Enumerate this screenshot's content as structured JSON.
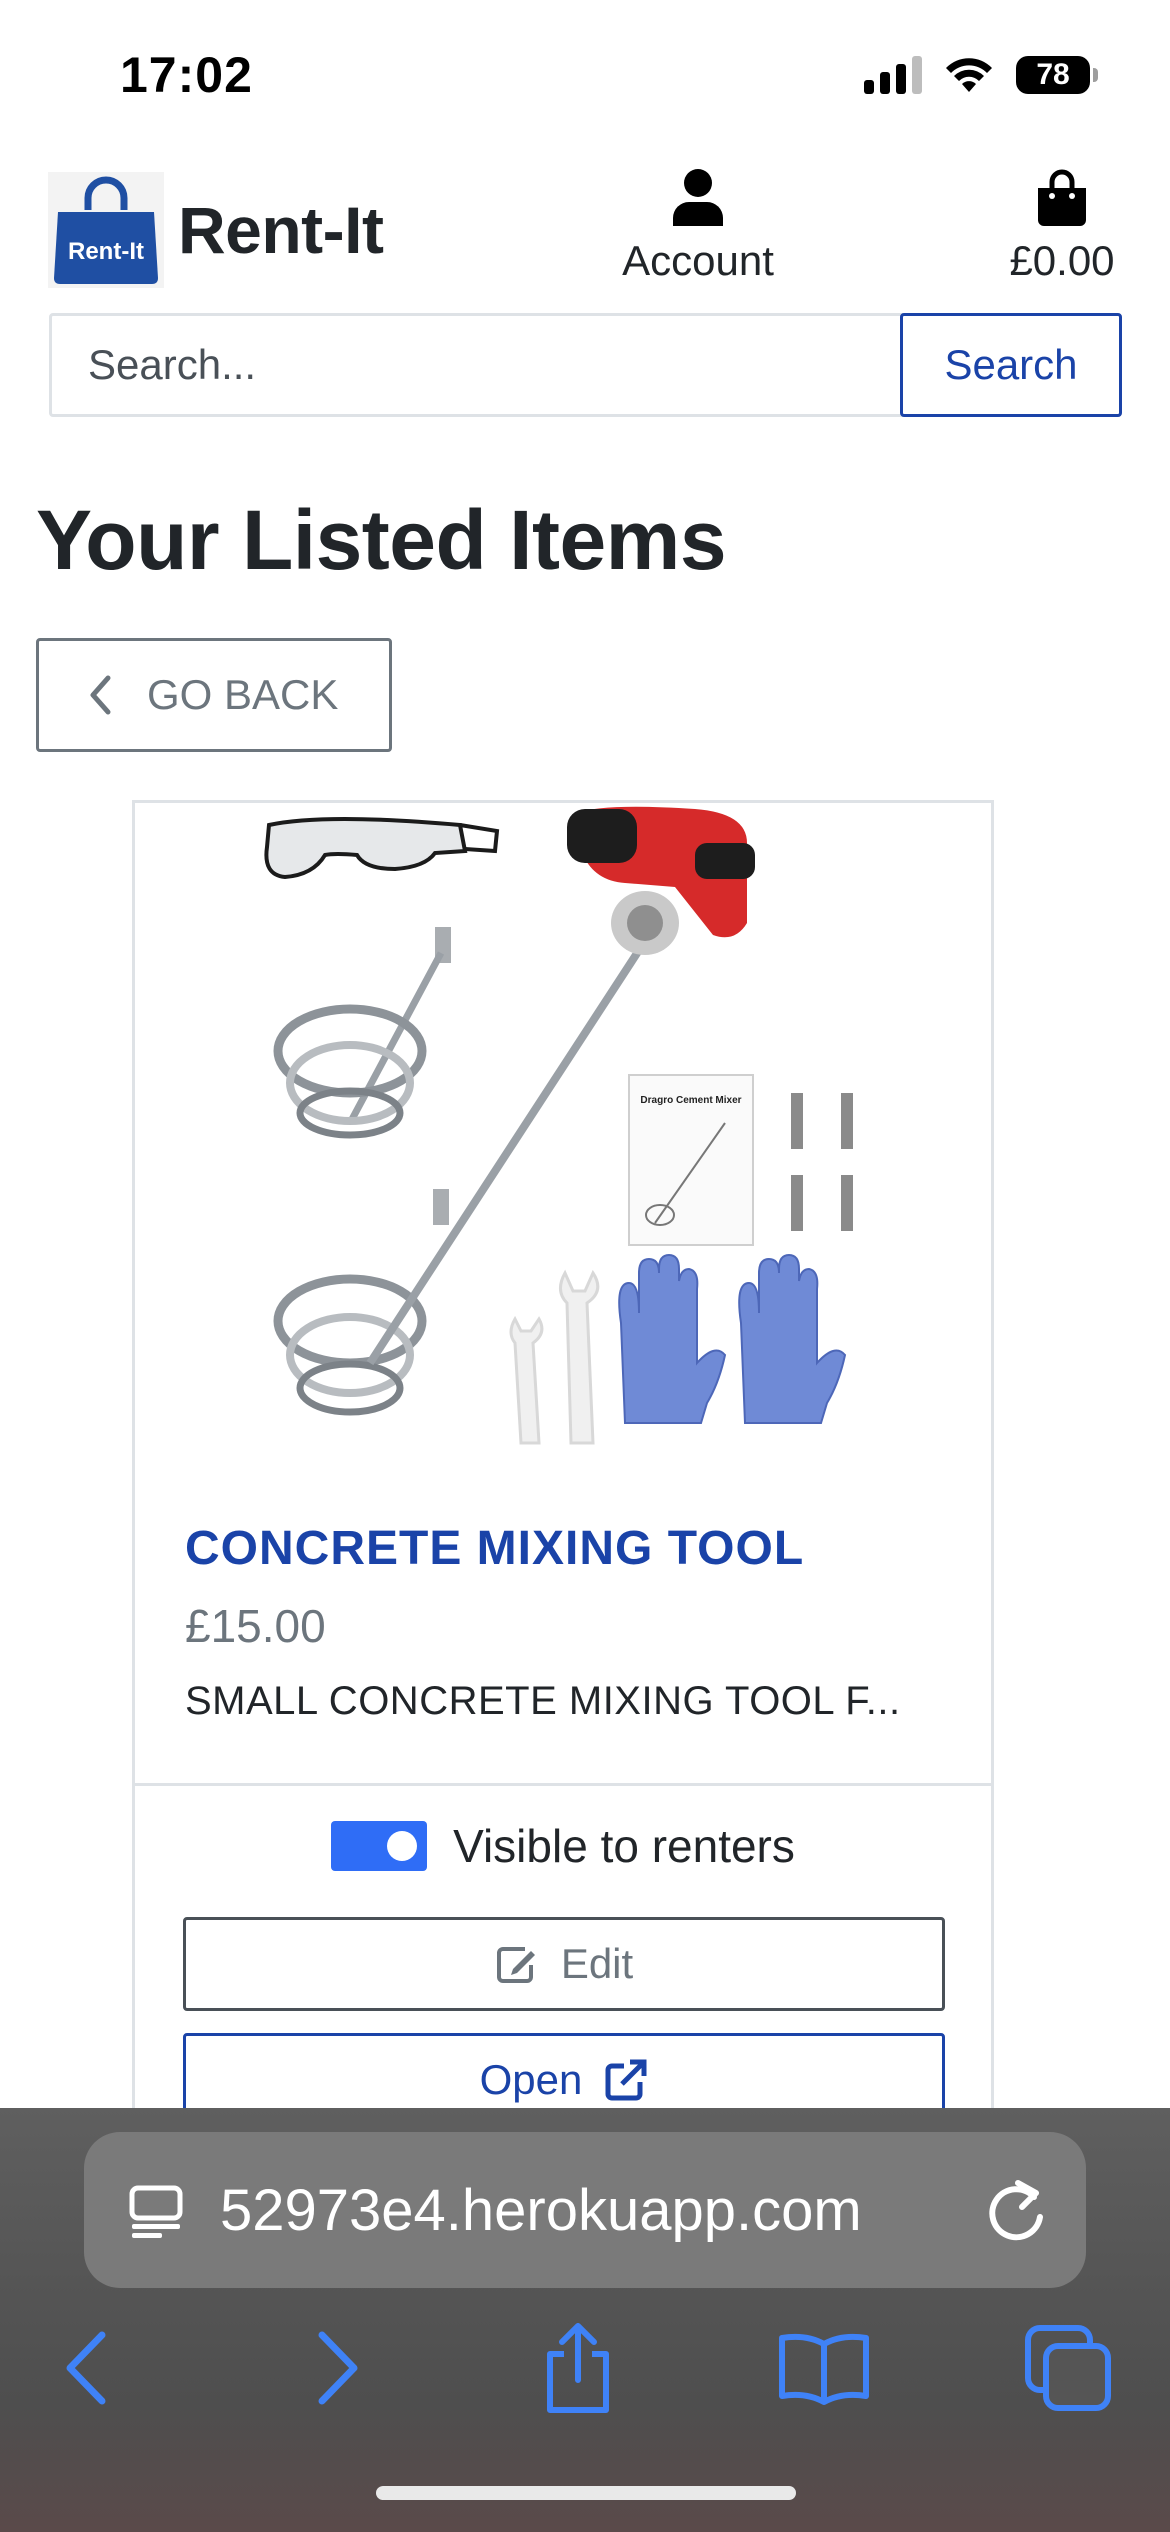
{
  "status_bar": {
    "time": "17:02",
    "battery": "78"
  },
  "header": {
    "brand_name": "Rent-It",
    "logo_text": "Rent-It",
    "account_label": "Account",
    "cart_total": "£0.00"
  },
  "search": {
    "placeholder": "Search...",
    "button_label": "Search"
  },
  "page": {
    "title": "Your Listed Items",
    "back_label": "GO BACK"
  },
  "item": {
    "title": "CONCRETE MIXING TOOL",
    "price": "£15.00",
    "description": "SMALL CONCRETE MIXING TOOL F...",
    "manual_text": "Dragro Cement Mixer",
    "visibility_label": "Visible to renters",
    "visible": true,
    "edit_label": "Edit",
    "open_label": "Open"
  },
  "browser": {
    "url": "52973e4.herokuapp.com"
  },
  "colors": {
    "brand_blue": "#1a43a8",
    "toggle_blue": "#2f6df6",
    "safari_accent": "#3f82f7"
  },
  "icons": [
    "signal-icon",
    "wifi-icon",
    "battery-icon",
    "bag-logo-icon",
    "person-icon",
    "shopping-bag-icon",
    "chevron-left-icon",
    "edit-icon",
    "external-link-icon",
    "page-menu-icon",
    "reload-icon",
    "back-arrow-icon",
    "forward-arrow-icon",
    "share-icon",
    "bookmarks-icon",
    "tabs-icon"
  ]
}
